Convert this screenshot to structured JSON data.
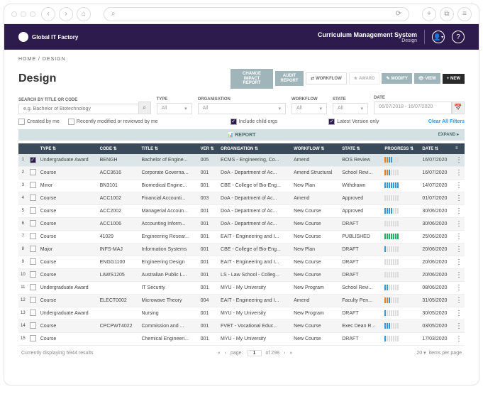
{
  "header": {
    "logo": "Global IT Factory",
    "title": "Curriculum Management System",
    "subtitle": "Design"
  },
  "breadcrumb": "HOME / DESIGN",
  "page_title": "Design",
  "actions": {
    "change_impact": "CHANGE IMPACT REPORT",
    "audit": "AUDIT REPORT",
    "workflow": "WORKFLOW",
    "award": "AWARD",
    "modify": "MODIFY",
    "view": "VIEW",
    "new": "+ NEW"
  },
  "filters": {
    "search_label": "SEARCH BY TITLE OR CODE",
    "search_placeholder": "e.g. Bachelor of Biotechnology",
    "type_label": "TYPE",
    "type_value": "All",
    "org_label": "ORGANISATION",
    "org_value": "All",
    "workflow_label": "WORKFLOW",
    "workflow_value": "All",
    "state_label": "STATE",
    "state_value": "All",
    "date_label": "DATE",
    "date_value": "06/07/2018 - 16/07/2020",
    "created_by_me": "Created by me",
    "recently_modified": "Recently modified or reviewed by me",
    "include_child": "Include child orgs",
    "latest_version": "Latest Version only",
    "clear_all": "Clear All Filters"
  },
  "report_bar": {
    "label": "REPORT",
    "expand": "EXPAND"
  },
  "columns": [
    "TYPE",
    "CODE",
    "TITLE",
    "VER",
    "ORGANISATION",
    "WORKFLOW",
    "STATE",
    "PROGRESS",
    "DATE"
  ],
  "rows": [
    {
      "n": 1,
      "sel": true,
      "type": "Undergraduate Award",
      "code": "BENGH",
      "title": "Bachelor of Engine...",
      "ver": "005",
      "org": "ECMS - Engineering, Co...",
      "wf": "Amend",
      "state": "BOS Review",
      "prog": [
        "#e67e22",
        "#e67e22",
        "#3498db",
        "#3498db",
        "#ddd",
        "#ddd",
        "#ddd"
      ],
      "date": "16/07/2020"
    },
    {
      "n": 2,
      "sel": false,
      "type": "Course",
      "code": "ACC3616",
      "title": "Corporate Governa...",
      "ver": "001",
      "org": "DoA - Department of Ac...",
      "wf": "Amend Structural",
      "state": "School Revi...",
      "prog": [
        "#e67e22",
        "#e67e22",
        "#3498db",
        "#ddd",
        "#ddd",
        "#ddd",
        "#ddd"
      ],
      "date": "16/07/2020"
    },
    {
      "n": 3,
      "sel": false,
      "type": "Minor",
      "code": "BN3101",
      "title": "Biomedical Engine...",
      "ver": "001",
      "org": "CBE - College of Bio-Eng...",
      "wf": "New Plan",
      "state": "Withdrawn",
      "prog": [
        "#3498db",
        "#3498db",
        "#3498db",
        "#3498db",
        "#3498db",
        "#3498db",
        "#3498db"
      ],
      "date": "14/07/2020"
    },
    {
      "n": 4,
      "sel": false,
      "type": "Course",
      "code": "ACC1002",
      "title": "Financial Accounti...",
      "ver": "003",
      "org": "DoA - Department of Ac...",
      "wf": "Amend",
      "state": "Approved",
      "prog": [
        "#ddd",
        "#ddd",
        "#ddd",
        "#ddd",
        "#ddd",
        "#ddd",
        "#ddd"
      ],
      "date": "01/07/2020"
    },
    {
      "n": 5,
      "sel": false,
      "type": "Course",
      "code": "ACC2002",
      "title": "Managerial Accoun...",
      "ver": "001",
      "org": "DoA - Department of Ac...",
      "wf": "New Course",
      "state": "Approved",
      "prog": [
        "#3498db",
        "#3498db",
        "#3498db",
        "#3498db",
        "#ddd",
        "#ddd",
        "#ddd"
      ],
      "date": "30/06/2020"
    },
    {
      "n": 6,
      "sel": false,
      "type": "Course",
      "code": "ACC1006",
      "title": "Accounting Inform...",
      "ver": "001",
      "org": "DoA - Department of Ac...",
      "wf": "New Course",
      "state": "DRAFT",
      "prog": [
        "#ddd",
        "#ddd",
        "#ddd",
        "#ddd",
        "#ddd",
        "#ddd",
        "#ddd"
      ],
      "date": "30/06/2020"
    },
    {
      "n": 7,
      "sel": false,
      "type": "Course",
      "code": "41029",
      "title": "Engineering Resear...",
      "ver": "001",
      "org": "EAIT - Engineering and I...",
      "wf": "New Course",
      "state": "PUBLISHED",
      "prog": [
        "#27ae60",
        "#27ae60",
        "#27ae60",
        "#27ae60",
        "#27ae60",
        "#27ae60",
        "#27ae60"
      ],
      "date": "25/06/2020"
    },
    {
      "n": 8,
      "sel": false,
      "type": "Major",
      "code": "INFS-MAJ",
      "title": "Information Systems",
      "ver": "001",
      "org": "CBE - College of Bio-Eng...",
      "wf": "New Plan",
      "state": "DRAFT",
      "prog": [
        "#3498db",
        "#ddd",
        "#ddd",
        "#ddd",
        "#ddd",
        "#ddd",
        "#ddd"
      ],
      "date": "20/06/2020"
    },
    {
      "n": 9,
      "sel": false,
      "type": "Course",
      "code": "ENGG1100",
      "title": "Engineering Design",
      "ver": "001",
      "org": "EAIT - Engineering and I...",
      "wf": "New Course",
      "state": "DRAFT",
      "prog": [
        "#ddd",
        "#ddd",
        "#ddd",
        "#ddd",
        "#ddd",
        "#ddd",
        "#ddd"
      ],
      "date": "20/06/2020"
    },
    {
      "n": 10,
      "sel": false,
      "type": "Course",
      "code": "LAWS1205",
      "title": "Australian Public L...",
      "ver": "001",
      "org": "LS - Law School - Colleg...",
      "wf": "New Course",
      "state": "DRAFT",
      "prog": [
        "#ddd",
        "#ddd",
        "#ddd",
        "#ddd",
        "#ddd",
        "#ddd",
        "#ddd"
      ],
      "date": "20/06/2020"
    },
    {
      "n": 11,
      "sel": false,
      "type": "Undergraduate Award",
      "code": "",
      "title": "IT Security",
      "ver": "001",
      "org": "MYU - My University",
      "wf": "New Program",
      "state": "School Revi...",
      "prog": [
        "#3498db",
        "#3498db",
        "#ddd",
        "#ddd",
        "#ddd",
        "#ddd",
        "#ddd"
      ],
      "date": "08/06/2020"
    },
    {
      "n": 12,
      "sel": false,
      "type": "Course",
      "code": "ELECT0002",
      "title": "Microwave Theory",
      "ver": "004",
      "org": "EAIT - Engineering and I...",
      "wf": "Amend",
      "state": "Faculty Pen...",
      "prog": [
        "#e67e22",
        "#e67e22",
        "#3498db",
        "#ddd",
        "#ddd",
        "#ddd",
        "#ddd"
      ],
      "date": "31/05/2020"
    },
    {
      "n": 13,
      "sel": false,
      "type": "Undergraduate Award",
      "code": "",
      "title": "Nursing",
      "ver": "001",
      "org": "MYU - My University",
      "wf": "New Program",
      "state": "DRAFT",
      "prog": [
        "#3498db",
        "#ddd",
        "#ddd",
        "#ddd",
        "#ddd",
        "#ddd",
        "#ddd"
      ],
      "date": "30/05/2020"
    },
    {
      "n": 14,
      "sel": false,
      "type": "Course",
      "code": "CPCPWT4022",
      "title": "Commission and ...",
      "ver": "001",
      "org": "FVET - Vocational Educ...",
      "wf": "New Course",
      "state": "Exec Dean R...",
      "prog": [
        "#3498db",
        "#3498db",
        "#3498db",
        "#ddd",
        "#ddd",
        "#ddd",
        "#ddd"
      ],
      "date": "03/05/2020"
    },
    {
      "n": 15,
      "sel": false,
      "type": "Course",
      "code": "",
      "title": "Chemical Engineeri...",
      "ver": "001",
      "org": "MYU - My University",
      "wf": "New Course",
      "state": "DRAFT",
      "prog": [
        "#3498db",
        "#ddd",
        "#ddd",
        "#ddd",
        "#ddd",
        "#ddd",
        "#ddd"
      ],
      "date": "17/03/2020"
    }
  ],
  "footer": {
    "count": "Currently displaying 5944 results",
    "page_label": "page:",
    "page_current": "1",
    "page_of": "of 298",
    "per_page_value": "20",
    "per_page_label": "items per page"
  }
}
